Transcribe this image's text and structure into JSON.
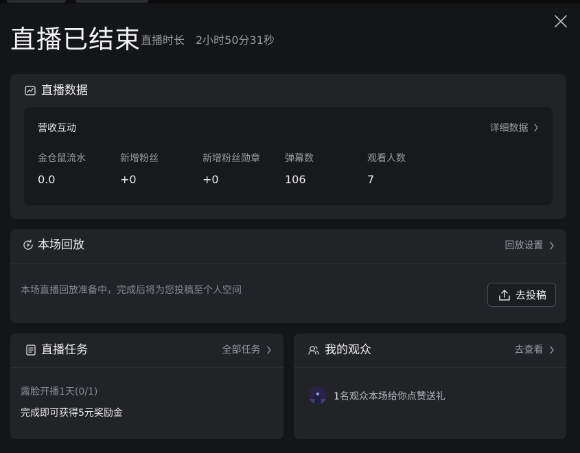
{
  "header": {
    "title": "直播已结束",
    "duration_label": "直播时长",
    "duration_value": "2小时50分31秒"
  },
  "stats_card": {
    "title": "直播数据",
    "icon": "trend-chart-icon",
    "section": "营收互动",
    "detail_link": "详细数据",
    "metrics": [
      {
        "label": "金仓鼠流水",
        "value": "0.0"
      },
      {
        "label": "新增粉丝",
        "value": "+0"
      },
      {
        "label": "新增粉丝勋章",
        "value": "+0"
      },
      {
        "label": "弹幕数",
        "value": "106"
      },
      {
        "label": "观看人数",
        "value": "7"
      }
    ]
  },
  "replay_card": {
    "title": "本场回放",
    "icon": "replay-play-icon",
    "settings_link": "回放设置",
    "message": "本场直播回放准备中，完成后将为您投稿至个人空间",
    "upload_button": "去投稿"
  },
  "task_card": {
    "title": "直播任务",
    "icon": "document-icon",
    "all_link": "全部任务",
    "task_name": "露脸开播1天(0/1)",
    "reward": "完成即可获得5元奖励金"
  },
  "audience_card": {
    "title": "我的观众",
    "icon": "users-icon",
    "view_link": "去查看",
    "count": "1",
    "message": "名观众本场给你点赞送礼"
  },
  "colors": {
    "background": "#141517",
    "card": "#222327",
    "inner_panel": "#18191b",
    "muted_text": "#9a9ba0"
  }
}
